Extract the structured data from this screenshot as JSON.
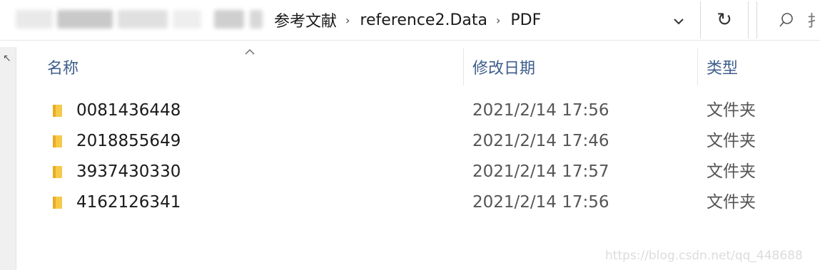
{
  "breadcrumb": {
    "items": [
      "参考文献",
      "reference2.Data",
      "PDF"
    ],
    "separator": "›"
  },
  "toolbar": {
    "dropdown_glyph": "⌄",
    "refresh_glyph": "↻",
    "search_glyph": "⚲",
    "search_text": "扌"
  },
  "columns": {
    "name": "名称",
    "date": "修改日期",
    "type": "类型"
  },
  "rows": [
    {
      "name": "0081436448",
      "date": "2021/2/14 17:56",
      "type": "文件夹"
    },
    {
      "name": "2018855649",
      "date": "2021/2/14 17:46",
      "type": "文件夹"
    },
    {
      "name": "3937430330",
      "date": "2021/2/14 17:57",
      "type": "文件夹"
    },
    {
      "name": "4162126341",
      "date": "2021/2/14 17:56",
      "type": "文件夹"
    }
  ],
  "watermark": "https://blog.csdn.net/qq_448688",
  "colors": {
    "folder": "#f7c948",
    "folder_dark": "#e6ad24",
    "header_text": "#3e5d8c"
  },
  "icons": {
    "folder": "folder-icon",
    "refresh": "refresh-icon",
    "search": "search-icon",
    "dropdown": "chevron-down-icon"
  }
}
